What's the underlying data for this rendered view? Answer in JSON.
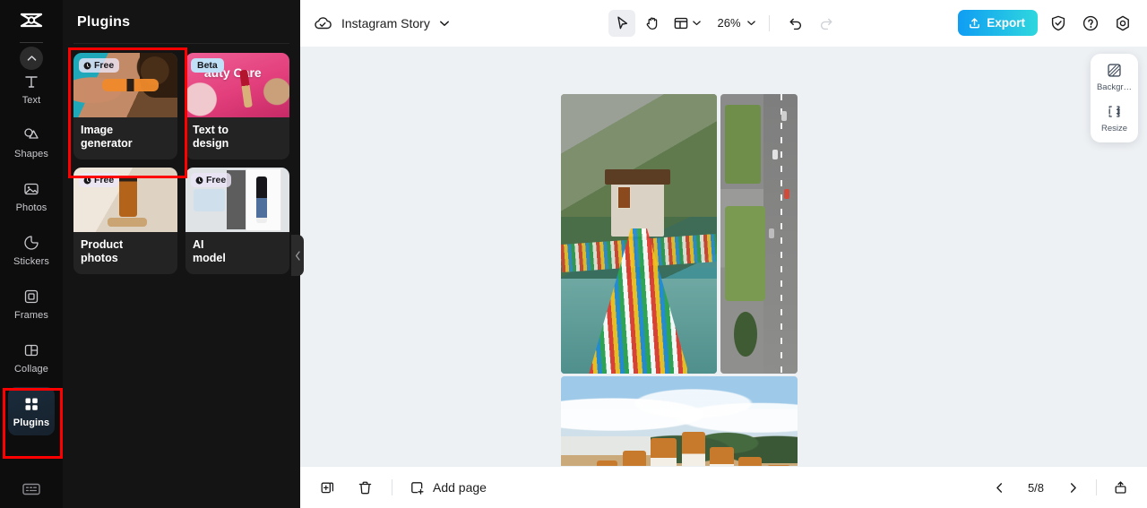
{
  "rail": {
    "logo_icon": "capcut-logo-icon",
    "collapse_icon": "chevron-up-icon",
    "items": [
      {
        "label": "Text",
        "icon": "text-icon"
      },
      {
        "label": "Shapes",
        "icon": "shapes-icon"
      },
      {
        "label": "Photos",
        "icon": "photos-icon"
      },
      {
        "label": "Stickers",
        "icon": "stickers-icon"
      },
      {
        "label": "Frames",
        "icon": "frames-icon"
      },
      {
        "label": "Collage",
        "icon": "collage-icon"
      },
      {
        "label": "Plugins",
        "icon": "plugins-grid-icon"
      }
    ],
    "bottom_icon": "keyboard-icon"
  },
  "panel": {
    "title": "Plugins",
    "collapse_handle_icon": "chevron-left-icon",
    "cards": [
      {
        "name": "Image\ngenerator",
        "title_line1": "Image",
        "title_line2": "generator",
        "badge": "Free",
        "badge_type": "free",
        "badge_icon": "clock-icon"
      },
      {
        "name": "Text to design",
        "title_line1": "Text to",
        "title_line2": "design",
        "badge": "Beta",
        "badge_type": "beta",
        "thumb_text": "auty Care"
      },
      {
        "name": "Product photos",
        "title_line1": "Product",
        "title_line2": "photos",
        "badge": "Free",
        "badge_type": "free",
        "badge_icon": "clock-icon"
      },
      {
        "name": "AI model",
        "title_line1": "AI",
        "title_line2": "model",
        "badge": "Free",
        "badge_type": "free",
        "badge_icon": "clock-icon"
      }
    ]
  },
  "topbar": {
    "cloud_icon": "cloud-check-icon",
    "doc_title": "Instagram Story",
    "doc_caret_icon": "chevron-down-icon",
    "tools": [
      {
        "name": "select-tool",
        "icon": "cursor-arrow-icon",
        "selected": true
      },
      {
        "name": "hand-tool",
        "icon": "hand-icon",
        "selected": false
      }
    ],
    "layout_icon": "layout-panel-icon",
    "layout_caret_icon": "chevron-down-icon",
    "zoom_value": "26%",
    "zoom_caret_icon": "chevron-down-icon",
    "undo_icon": "undo-arrow-icon",
    "redo_icon": "redo-arrow-icon",
    "export_label": "Export",
    "export_icon": "upload-icon",
    "export_color": "#16b4ed",
    "shield_icon": "shield-check-icon",
    "help_icon": "question-circle-icon",
    "settings_icon": "gear-hex-icon"
  },
  "float_tools": {
    "items": [
      {
        "label": "Backgr…",
        "icon": "background-fill-icon"
      },
      {
        "label": "Resize",
        "icon": "resize-icon"
      }
    ]
  },
  "bottombar": {
    "duplicate_icon": "duplicate-page-icon",
    "delete_icon": "trash-icon",
    "add_page_label": "Add page",
    "add_page_icon": "add-square-icon",
    "prev_icon": "chevron-left-icon",
    "page_indicator": "5/8",
    "next_icon": "chevron-right-icon",
    "expand_icon": "expand-pages-icon"
  },
  "canvas": {
    "background_color": "#eef1f4",
    "photos": [
      {
        "name": "bhutan-suspension-bridge-photo"
      },
      {
        "name": "aerial-street-view-photo"
      },
      {
        "name": "dochula-chortens-photo"
      }
    ]
  }
}
